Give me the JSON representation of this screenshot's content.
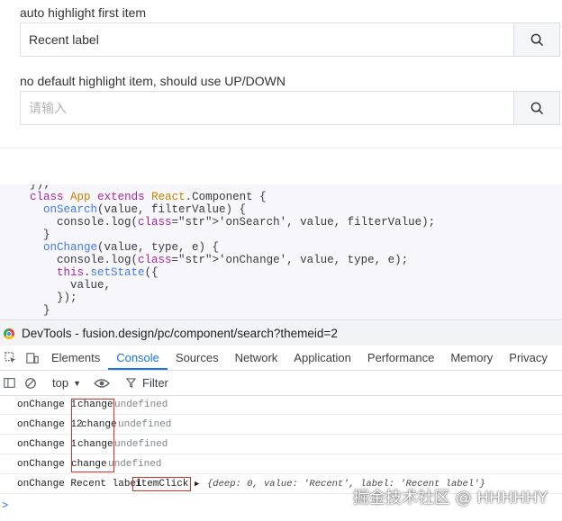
{
  "demo": {
    "section1_label": "auto highlight first item",
    "search1_value": "Recent label",
    "section2_label": "no default highlight item, should use UP/DOWN",
    "search2_placeholder": "请输入"
  },
  "code": {
    "lines": [
      "});",
      "class App extends React.Component {",
      "  onSearch(value, filterValue) {",
      "    console.log('onSearch', value, filterValue);",
      "  }",
      "  onChange(value, type, e) {",
      "    console.log('onChange', value, type, e);",
      "    this.setState({",
      "      value,",
      "    });",
      "  }",
      "  ..."
    ]
  },
  "devtools": {
    "title": "DevTools - fusion.design/pc/component/search?themeid=2",
    "tabs": [
      "Elements",
      "Console",
      "Sources",
      "Network",
      "Application",
      "Performance",
      "Memory",
      "Privacy"
    ],
    "active_tab": "Console",
    "context": "top",
    "filter_label": "Filter",
    "logs": [
      {
        "prefix": "onChange 1",
        "type": "change",
        "rest": "undefined"
      },
      {
        "prefix": "onChange 12",
        "type": "change",
        "rest": "undefined"
      },
      {
        "prefix": "onChange 1",
        "type": "change",
        "rest": "undefined"
      },
      {
        "prefix": "onChange ",
        "type": "change",
        "rest": "undefined"
      },
      {
        "prefix": "onChange Recent label",
        "type": "itemClick",
        "rest": "{deep: 0, value: 'Recent', label: 'Recent label'}"
      }
    ],
    "prompt": ">"
  },
  "watermark": "掘金技术社区 @ HHHHHY",
  "colors": {
    "accent": "#1a73e8",
    "highlight_box": "#d93025"
  }
}
